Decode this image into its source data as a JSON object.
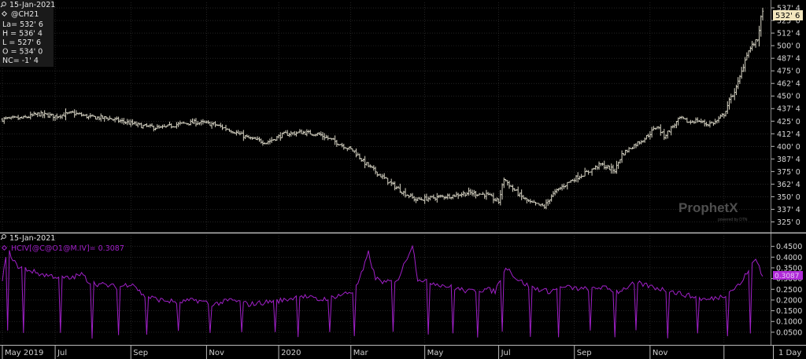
{
  "chart_data": [
    {
      "type": "ohlc",
      "panel": "price",
      "date": "15-Jan-2021",
      "symbol": "@CH21",
      "legend": [
        {
          "label": "La=",
          "value": "532' 6"
        },
        {
          "label": "H =",
          "value": "536' 4"
        },
        {
          "label": "L =",
          "value": "527' 6"
        },
        {
          "label": "O =",
          "value": "534' 0"
        },
        {
          "label": "NC=",
          "value": "-1' 4"
        }
      ],
      "last_price_label": "532' 6",
      "watermark": "ProphetX",
      "watermark_sub": "powered by DTN",
      "ylim": [
        316,
        543
      ],
      "yticks": [
        {
          "v": 325,
          "t": "325' 0"
        },
        {
          "v": 337.5,
          "t": "337' 4"
        },
        {
          "v": 350,
          "t": "350' 0"
        },
        {
          "v": 362.5,
          "t": "362' 4"
        },
        {
          "v": 375,
          "t": "375' 0"
        },
        {
          "v": 387.5,
          "t": "387' 4"
        },
        {
          "v": 400,
          "t": "400' 0"
        },
        {
          "v": 412.5,
          "t": "412' 4"
        },
        {
          "v": 425,
          "t": "425' 0"
        },
        {
          "v": 437.5,
          "t": "437' 4"
        },
        {
          "v": 450,
          "t": "450' 0"
        },
        {
          "v": 462.5,
          "t": "462' 4"
        },
        {
          "v": 475,
          "t": "475' 0"
        },
        {
          "v": 487.5,
          "t": "487' 4"
        },
        {
          "v": 500,
          "t": "500' 0"
        },
        {
          "v": 512.5,
          "t": "512' 4"
        },
        {
          "v": 525,
          "t": "525' 0"
        },
        {
          "v": 537.5,
          "t": "537' 4"
        }
      ],
      "anchors": [
        [
          0,
          427
        ],
        [
          12,
          428
        ],
        [
          20,
          432
        ],
        [
          30,
          430
        ],
        [
          40,
          433
        ],
        [
          50,
          429
        ],
        [
          60,
          428
        ],
        [
          70,
          424
        ],
        [
          80,
          420
        ],
        [
          90,
          418
        ],
        [
          100,
          422
        ],
        [
          110,
          424
        ],
        [
          120,
          422
        ],
        [
          130,
          416
        ],
        [
          140,
          408
        ],
        [
          150,
          404
        ],
        [
          160,
          412
        ],
        [
          170,
          414
        ],
        [
          180,
          412
        ],
        [
          190,
          404
        ],
        [
          200,
          395
        ],
        [
          205,
          385
        ],
        [
          212,
          375
        ],
        [
          220,
          364
        ],
        [
          228,
          354
        ],
        [
          235,
          347
        ],
        [
          245,
          349
        ],
        [
          255,
          351
        ],
        [
          265,
          354
        ],
        [
          275,
          352
        ],
        [
          282,
          345
        ],
        [
          285,
          368
        ],
        [
          290,
          358
        ],
        [
          295,
          350
        ],
        [
          300,
          344
        ],
        [
          308,
          340
        ],
        [
          312,
          351
        ],
        [
          318,
          360
        ],
        [
          325,
          368
        ],
        [
          332,
          374
        ],
        [
          340,
          382
        ],
        [
          348,
          376
        ],
        [
          352,
          392
        ],
        [
          358,
          400
        ],
        [
          365,
          408
        ],
        [
          372,
          420
        ],
        [
          376,
          410
        ],
        [
          380,
          418
        ],
        [
          385,
          428
        ],
        [
          390,
          424
        ],
        [
          395,
          426
        ],
        [
          400,
          422
        ],
        [
          405,
          424
        ],
        [
          410,
          432
        ],
        [
          413,
          445
        ],
        [
          417,
          458
        ],
        [
          420,
          474
        ],
        [
          423,
          492
        ],
        [
          426,
          500
        ],
        [
          429,
          506
        ],
        [
          431,
          527
        ],
        [
          432,
          532.75
        ]
      ]
    },
    {
      "type": "line",
      "panel": "volatility",
      "date": "15-Jan-2021",
      "series_label": "HCIV[@C@O1@M.IV]= 0.3087",
      "last_value_label": "0.3087",
      "ylim": [
        0.002,
        0.5
      ],
      "yticks": [
        {
          "v": 0.05,
          "t": "0.0500"
        },
        {
          "v": 0.1,
          "t": "0.1000"
        },
        {
          "v": 0.15,
          "t": "0.1500"
        },
        {
          "v": 0.2,
          "t": "0.2000"
        },
        {
          "v": 0.25,
          "t": "0.2500"
        },
        {
          "v": 0.3,
          "t": "0.3000"
        },
        {
          "v": 0.35,
          "t": "0.3500"
        },
        {
          "v": 0.4,
          "t": "0.4000"
        },
        {
          "v": 0.45,
          "t": "0.4500"
        }
      ],
      "anchors": [
        [
          0,
          0.3
        ],
        [
          3,
          0.44
        ],
        [
          8,
          0.36
        ],
        [
          15,
          0.34
        ],
        [
          22,
          0.32
        ],
        [
          30,
          0.31
        ],
        [
          38,
          0.3
        ],
        [
          45,
          0.32
        ],
        [
          50,
          0.28
        ],
        [
          58,
          0.27
        ],
        [
          66,
          0.26
        ],
        [
          74,
          0.28
        ],
        [
          80,
          0.22
        ],
        [
          90,
          0.2
        ],
        [
          100,
          0.19
        ],
        [
          110,
          0.2
        ],
        [
          120,
          0.18
        ],
        [
          130,
          0.2
        ],
        [
          140,
          0.18
        ],
        [
          150,
          0.19
        ],
        [
          160,
          0.2
        ],
        [
          170,
          0.22
        ],
        [
          180,
          0.2
        ],
        [
          190,
          0.22
        ],
        [
          200,
          0.24
        ],
        [
          205,
          0.34
        ],
        [
          208,
          0.42
        ],
        [
          212,
          0.3
        ],
        [
          218,
          0.28
        ],
        [
          225,
          0.3
        ],
        [
          230,
          0.4
        ],
        [
          233,
          0.46
        ],
        [
          236,
          0.3
        ],
        [
          245,
          0.28
        ],
        [
          255,
          0.26
        ],
        [
          265,
          0.24
        ],
        [
          275,
          0.25
        ],
        [
          280,
          0.24
        ],
        [
          286,
          0.36
        ],
        [
          292,
          0.3
        ],
        [
          300,
          0.26
        ],
        [
          310,
          0.24
        ],
        [
          320,
          0.26
        ],
        [
          330,
          0.25
        ],
        [
          340,
          0.26
        ],
        [
          350,
          0.24
        ],
        [
          360,
          0.28
        ],
        [
          370,
          0.26
        ],
        [
          380,
          0.24
        ],
        [
          390,
          0.22
        ],
        [
          400,
          0.2
        ],
        [
          410,
          0.22
        ],
        [
          420,
          0.28
        ],
        [
          425,
          0.36
        ],
        [
          428,
          0.39
        ],
        [
          430,
          0.36
        ],
        [
          432,
          0.3087
        ]
      ],
      "dips": [
        3,
        12,
        33,
        51,
        66,
        82,
        100,
        118,
        136,
        155,
        168,
        186,
        200,
        222,
        242,
        256,
        270,
        284,
        300,
        316,
        334,
        348,
        360,
        378,
        395,
        412,
        425
      ],
      "dip_level": 0.02
    }
  ],
  "x_axis": {
    "n_bars": 433,
    "labels": [
      {
        "i": 0,
        "t": "May 2019"
      },
      {
        "i": 30,
        "t": "Jul"
      },
      {
        "i": 73,
        "t": "Sep"
      },
      {
        "i": 116,
        "t": "Nov"
      },
      {
        "i": 157,
        "t": "2020"
      },
      {
        "i": 198,
        "t": "Mar"
      },
      {
        "i": 240,
        "t": "May"
      },
      {
        "i": 282,
        "t": "Jul"
      },
      {
        "i": 325,
        "t": "Sep"
      },
      {
        "i": 368,
        "t": "Nov"
      },
      {
        "i": 410,
        "t": ""
      }
    ],
    "interval_label": "1 Day"
  },
  "colors": {
    "background": "#000000",
    "grid": "#3a3a3a",
    "bars": "#d9d6c6",
    "volatility": "#a020c8",
    "last_price_bg": "#f2e6bd",
    "last_vol_bg": "#b02ad8"
  }
}
